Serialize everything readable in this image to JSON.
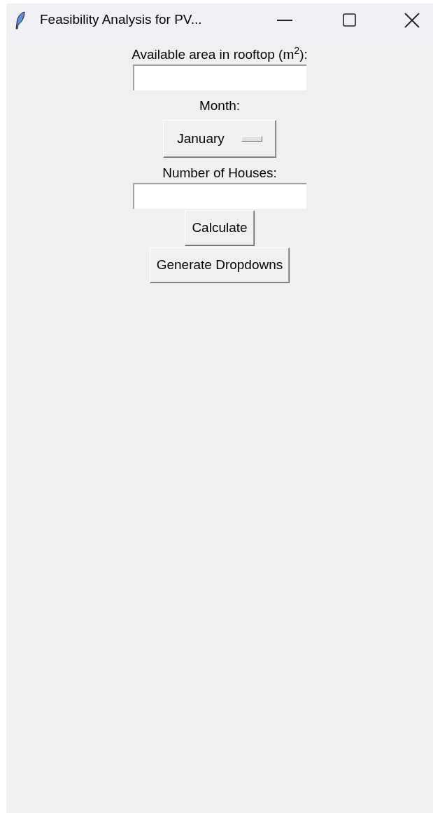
{
  "window": {
    "title": "Feasibility Analysis for PV..."
  },
  "form": [
    {
      "kind": "label",
      "text": "Available area in rooftop (m$^{2}$):"
    },
    {
      "kind": "entry"
    },
    {
      "kind": "label",
      "text": "Month:"
    },
    {
      "kind": "optionmenu",
      "value": "January"
    },
    {
      "kind": "label",
      "text": "Number of Houses:"
    },
    {
      "kind": "entry"
    },
    {
      "kind": "button",
      "text": "Calculate"
    },
    {
      "kind": "button",
      "text": "Generate Dropdowns"
    }
  ]
}
